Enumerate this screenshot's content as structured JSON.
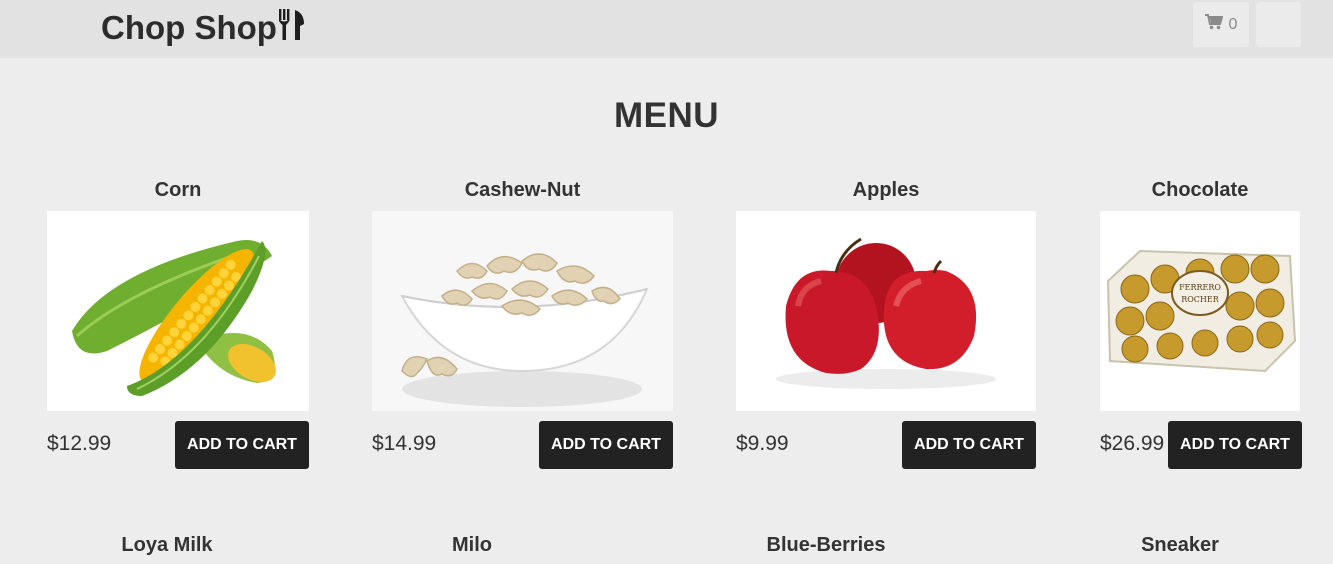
{
  "navbar": {
    "brand": "Chop Shop",
    "cart_count": "0"
  },
  "menu_title": "MENU",
  "products": [
    {
      "name": "Corn",
      "price": "$12.99",
      "button": "ADD TO CART"
    },
    {
      "name": "Cashew-Nut",
      "price": "$14.99",
      "button": "ADD TO CART"
    },
    {
      "name": "Apples",
      "price": "$9.99",
      "button": "ADD TO CART"
    },
    {
      "name": "Chocolate",
      "price": "$26.99",
      "button": "ADD TO CART"
    }
  ],
  "products_row2": [
    {
      "name": "Loya Milk"
    },
    {
      "name": "Milo"
    },
    {
      "name": "Blue-Berries"
    },
    {
      "name": "Sneaker"
    }
  ],
  "image_labels": {
    "ferrero": "FERRERO ROCHER"
  },
  "colors": {
    "navbar_bg": "#e3e2e3",
    "page_bg": "#ededed",
    "button_bg": "#222222",
    "button_text": "#ffffff"
  },
  "icons": {
    "brand": "cutlery-icon",
    "cart": "cart-icon"
  }
}
